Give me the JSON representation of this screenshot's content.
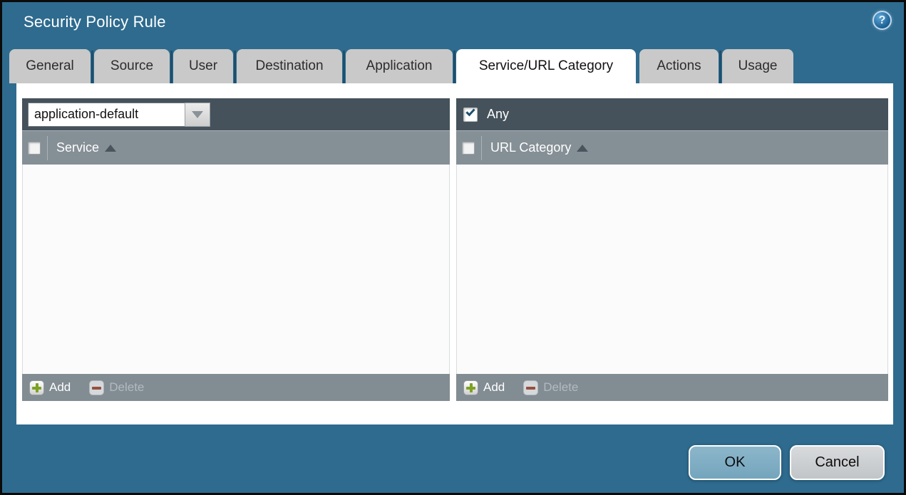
{
  "window": {
    "title": "Security Policy Rule"
  },
  "icons": {
    "help_glyph": "?"
  },
  "tabs": [
    {
      "label": "General",
      "active": false
    },
    {
      "label": "Source",
      "active": false
    },
    {
      "label": "User",
      "active": false
    },
    {
      "label": "Destination",
      "active": false
    },
    {
      "label": "Application",
      "active": false
    },
    {
      "label": "Service/URL Category",
      "active": true
    },
    {
      "label": "Actions",
      "active": false
    },
    {
      "label": "Usage",
      "active": false
    }
  ],
  "service_panel": {
    "dropdown_value": "application-default",
    "column_header": "Service",
    "select_all_checked": false,
    "rows": [],
    "add_label": "Add",
    "delete_label": "Delete",
    "delete_enabled": false
  },
  "url_category_panel": {
    "any_label": "Any",
    "any_checked": true,
    "column_header": "URL Category",
    "select_all_checked": false,
    "rows": [],
    "add_label": "Add",
    "delete_label": "Delete",
    "delete_enabled": false
  },
  "footer": {
    "ok_label": "OK",
    "cancel_label": "Cancel"
  },
  "colors": {
    "frame_teal": "#2e6b8e",
    "panel_topbar": "#45525b",
    "column_header_gray": "#858f96",
    "footer_bar_gray": "#828c93",
    "active_tab": "#ffffff",
    "inactive_tab": "#c9c9c9",
    "add_icon_green": "#7da224",
    "delete_icon_red": "#95503f",
    "ok_button_blue": "#7fadc4",
    "cancel_button_gray": "#cbcfd2",
    "help_icon_blue": "#2270a8",
    "checkbox_check_blue": "#1f4e6e"
  }
}
